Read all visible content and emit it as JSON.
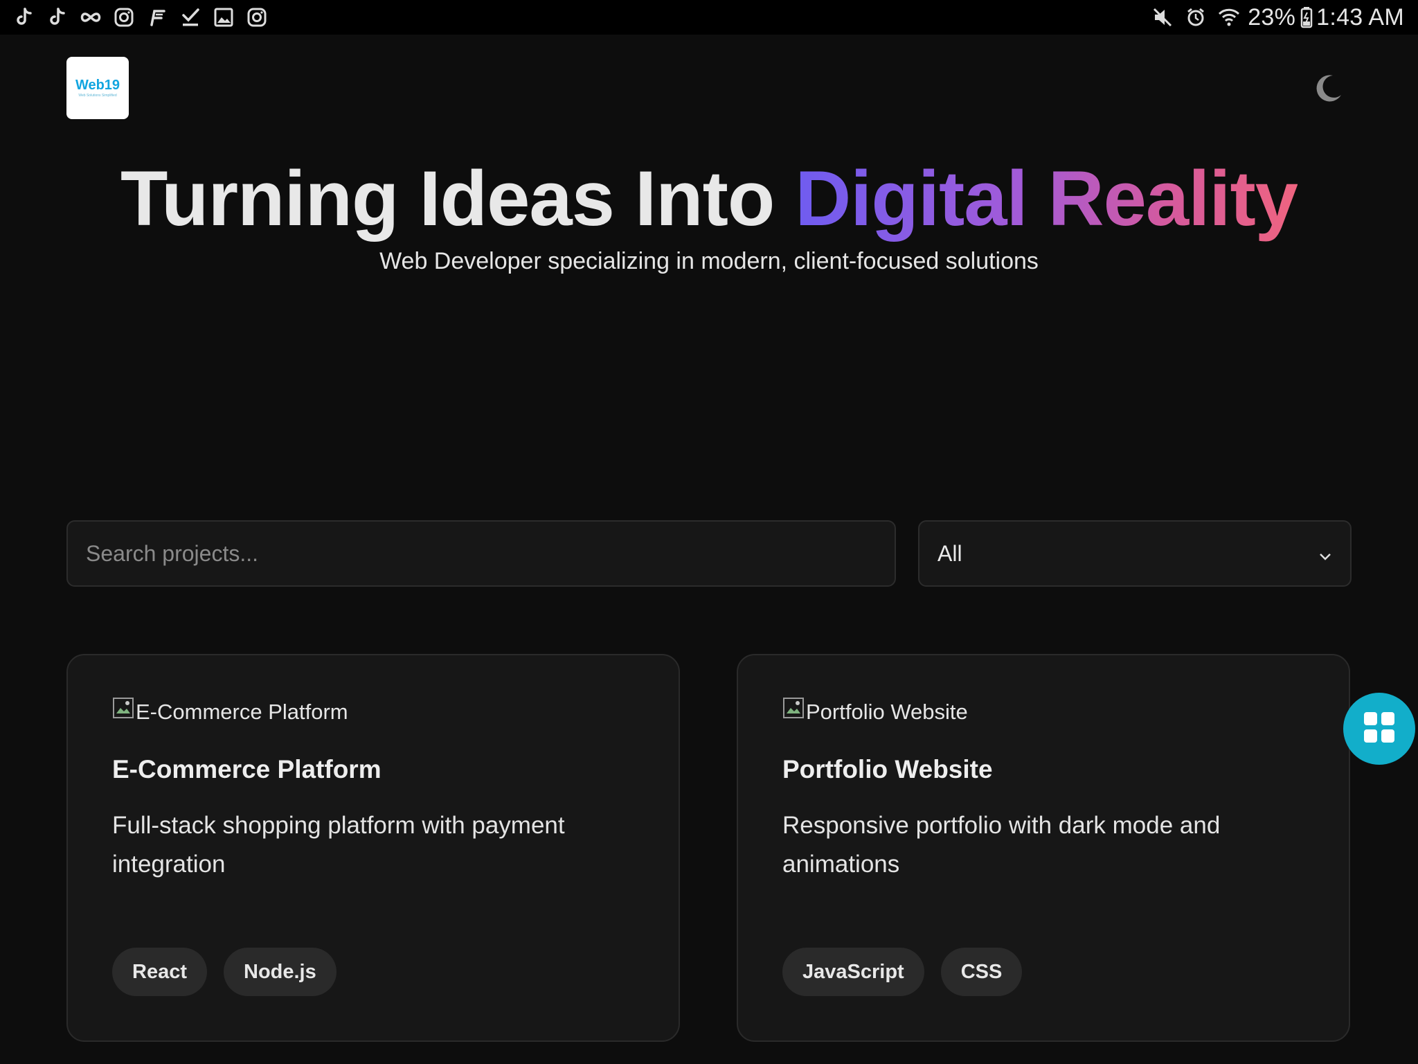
{
  "status_bar": {
    "left_icons": [
      "tiktok-icon",
      "tiktok-icon",
      "infinity-icon",
      "instagram-icon",
      "app-f-icon",
      "download-done-icon",
      "gallery-icon",
      "instagram-icon"
    ],
    "right_icons": [
      "mute-icon",
      "alarm-icon",
      "wifi-icon"
    ],
    "battery_percent": "23%",
    "time": "1:43 AM"
  },
  "header": {
    "logo_text": "Web19",
    "logo_subtext": "Web Solutions Simplified"
  },
  "hero": {
    "title_plain": "Turning Ideas Into ",
    "title_highlight": "Digital Reality",
    "subtitle": "Web Developer specializing in modern, client-focused solutions",
    "gradient_colors": [
      "#6f5cf0",
      "#a35bd8",
      "#d65a9c",
      "#ef6480"
    ]
  },
  "filters": {
    "search_placeholder": "Search projects...",
    "search_value": "",
    "category_selected": "All"
  },
  "projects": [
    {
      "image_alt": "E-Commerce Platform",
      "title": "E-Commerce Platform",
      "description": "Full-stack shopping platform with payment integration",
      "tags": [
        "React",
        "Node.js"
      ]
    },
    {
      "image_alt": "Portfolio Website",
      "title": "Portfolio Website",
      "description": "Responsive portfolio with dark mode and animations",
      "tags": [
        "JavaScript",
        "CSS"
      ]
    }
  ],
  "colors": {
    "background": "#0d0d0d",
    "card": "#171717",
    "fab": "#12aeca",
    "logo_accent": "#11a5e0"
  }
}
